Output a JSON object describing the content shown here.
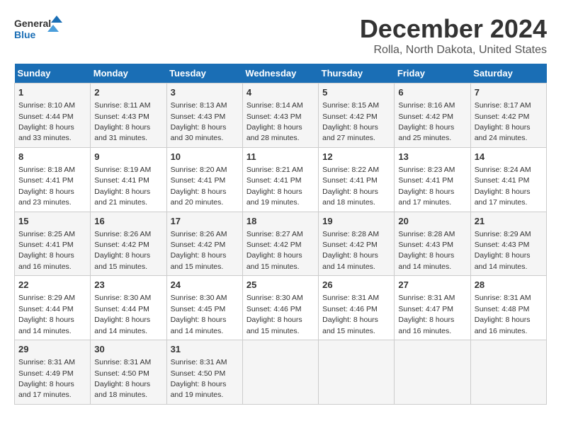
{
  "logo": {
    "line1": "General",
    "line2": "Blue"
  },
  "title": "December 2024",
  "subtitle": "Rolla, North Dakota, United States",
  "days_of_week": [
    "Sunday",
    "Monday",
    "Tuesday",
    "Wednesday",
    "Thursday",
    "Friday",
    "Saturday"
  ],
  "weeks": [
    [
      {
        "day": "1",
        "sunrise": "8:10 AM",
        "sunset": "4:44 PM",
        "daylight": "8 hours and 33 minutes."
      },
      {
        "day": "2",
        "sunrise": "8:11 AM",
        "sunset": "4:43 PM",
        "daylight": "8 hours and 31 minutes."
      },
      {
        "day": "3",
        "sunrise": "8:13 AM",
        "sunset": "4:43 PM",
        "daylight": "8 hours and 30 minutes."
      },
      {
        "day": "4",
        "sunrise": "8:14 AM",
        "sunset": "4:43 PM",
        "daylight": "8 hours and 28 minutes."
      },
      {
        "day": "5",
        "sunrise": "8:15 AM",
        "sunset": "4:42 PM",
        "daylight": "8 hours and 27 minutes."
      },
      {
        "day": "6",
        "sunrise": "8:16 AM",
        "sunset": "4:42 PM",
        "daylight": "8 hours and 25 minutes."
      },
      {
        "day": "7",
        "sunrise": "8:17 AM",
        "sunset": "4:42 PM",
        "daylight": "8 hours and 24 minutes."
      }
    ],
    [
      {
        "day": "8",
        "sunrise": "8:18 AM",
        "sunset": "4:41 PM",
        "daylight": "8 hours and 23 minutes."
      },
      {
        "day": "9",
        "sunrise": "8:19 AM",
        "sunset": "4:41 PM",
        "daylight": "8 hours and 21 minutes."
      },
      {
        "day": "10",
        "sunrise": "8:20 AM",
        "sunset": "4:41 PM",
        "daylight": "8 hours and 20 minutes."
      },
      {
        "day": "11",
        "sunrise": "8:21 AM",
        "sunset": "4:41 PM",
        "daylight": "8 hours and 19 minutes."
      },
      {
        "day": "12",
        "sunrise": "8:22 AM",
        "sunset": "4:41 PM",
        "daylight": "8 hours and 18 minutes."
      },
      {
        "day": "13",
        "sunrise": "8:23 AM",
        "sunset": "4:41 PM",
        "daylight": "8 hours and 17 minutes."
      },
      {
        "day": "14",
        "sunrise": "8:24 AM",
        "sunset": "4:41 PM",
        "daylight": "8 hours and 17 minutes."
      }
    ],
    [
      {
        "day": "15",
        "sunrise": "8:25 AM",
        "sunset": "4:41 PM",
        "daylight": "8 hours and 16 minutes."
      },
      {
        "day": "16",
        "sunrise": "8:26 AM",
        "sunset": "4:42 PM",
        "daylight": "8 hours and 15 minutes."
      },
      {
        "day": "17",
        "sunrise": "8:26 AM",
        "sunset": "4:42 PM",
        "daylight": "8 hours and 15 minutes."
      },
      {
        "day": "18",
        "sunrise": "8:27 AM",
        "sunset": "4:42 PM",
        "daylight": "8 hours and 15 minutes."
      },
      {
        "day": "19",
        "sunrise": "8:28 AM",
        "sunset": "4:42 PM",
        "daylight": "8 hours and 14 minutes."
      },
      {
        "day": "20",
        "sunrise": "8:28 AM",
        "sunset": "4:43 PM",
        "daylight": "8 hours and 14 minutes."
      },
      {
        "day": "21",
        "sunrise": "8:29 AM",
        "sunset": "4:43 PM",
        "daylight": "8 hours and 14 minutes."
      }
    ],
    [
      {
        "day": "22",
        "sunrise": "8:29 AM",
        "sunset": "4:44 PM",
        "daylight": "8 hours and 14 minutes."
      },
      {
        "day": "23",
        "sunrise": "8:30 AM",
        "sunset": "4:44 PM",
        "daylight": "8 hours and 14 minutes."
      },
      {
        "day": "24",
        "sunrise": "8:30 AM",
        "sunset": "4:45 PM",
        "daylight": "8 hours and 14 minutes."
      },
      {
        "day": "25",
        "sunrise": "8:30 AM",
        "sunset": "4:46 PM",
        "daylight": "8 hours and 15 minutes."
      },
      {
        "day": "26",
        "sunrise": "8:31 AM",
        "sunset": "4:46 PM",
        "daylight": "8 hours and 15 minutes."
      },
      {
        "day": "27",
        "sunrise": "8:31 AM",
        "sunset": "4:47 PM",
        "daylight": "8 hours and 16 minutes."
      },
      {
        "day": "28",
        "sunrise": "8:31 AM",
        "sunset": "4:48 PM",
        "daylight": "8 hours and 16 minutes."
      }
    ],
    [
      {
        "day": "29",
        "sunrise": "8:31 AM",
        "sunset": "4:49 PM",
        "daylight": "8 hours and 17 minutes."
      },
      {
        "day": "30",
        "sunrise": "8:31 AM",
        "sunset": "4:50 PM",
        "daylight": "8 hours and 18 minutes."
      },
      {
        "day": "31",
        "sunrise": "8:31 AM",
        "sunset": "4:50 PM",
        "daylight": "8 hours and 19 minutes."
      },
      null,
      null,
      null,
      null
    ]
  ]
}
